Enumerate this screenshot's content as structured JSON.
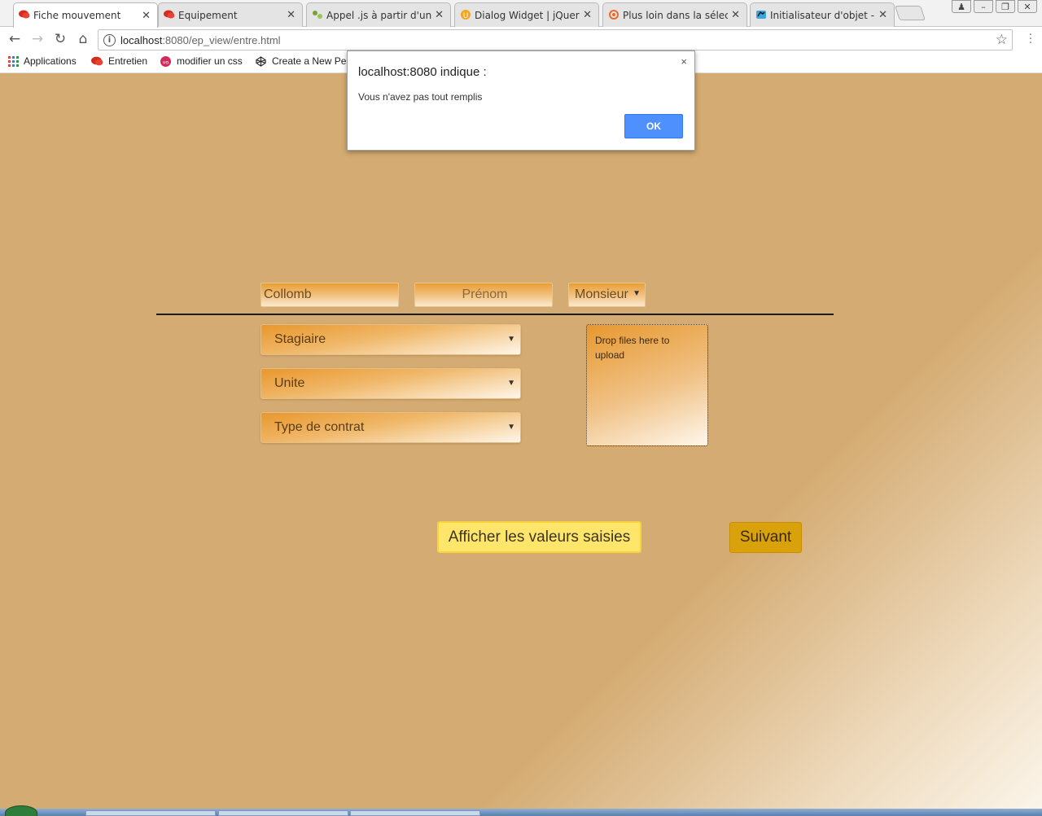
{
  "browser": {
    "tabs": [
      {
        "title": "Fiche mouvement",
        "active": true,
        "icon": "red-speech-icon"
      },
      {
        "title": "Equipement",
        "active": false,
        "icon": "red-speech-icon"
      },
      {
        "title": "Appel .js à partir d'un j",
        "active": false,
        "icon": "green-dots-icon"
      },
      {
        "title": "Dialog Widget | jQuery",
        "active": false,
        "icon": "orange-u-icon"
      },
      {
        "title": "Plus loin dans la sélect",
        "active": false,
        "icon": "orange-swirl-icon"
      },
      {
        "title": "Initialisateur d'objet - J",
        "active": false,
        "icon": "blue-dino-icon"
      }
    ],
    "url_host": "localhost",
    "url_path": ":8080/ep_view/entre.html",
    "bookmarks": [
      "Applications",
      "Entretien",
      "modifier un css",
      "Create a New Pen"
    ]
  },
  "alert": {
    "title": "localhost:8080 indique :",
    "message": "Vous n'avez pas tout remplis",
    "ok_label": "OK",
    "close_label": "×"
  },
  "form": {
    "nom_value": "Collomb",
    "prenom_placeholder": "Prénom",
    "civilite_selected": "Monsieur",
    "statut_selected": "Stagiaire",
    "unite_selected": "Unite",
    "contrat_selected": "Type de contrat",
    "dropzone_text": "Drop files here to upload",
    "show_button": "Afficher les valeurs saisies",
    "next_button": "Suivant"
  },
  "colors": {
    "page_bg": "#d4ab72",
    "ok_button": "#4d90fe",
    "show_button": "#ffe66b",
    "next_button": "#d9a10a"
  }
}
